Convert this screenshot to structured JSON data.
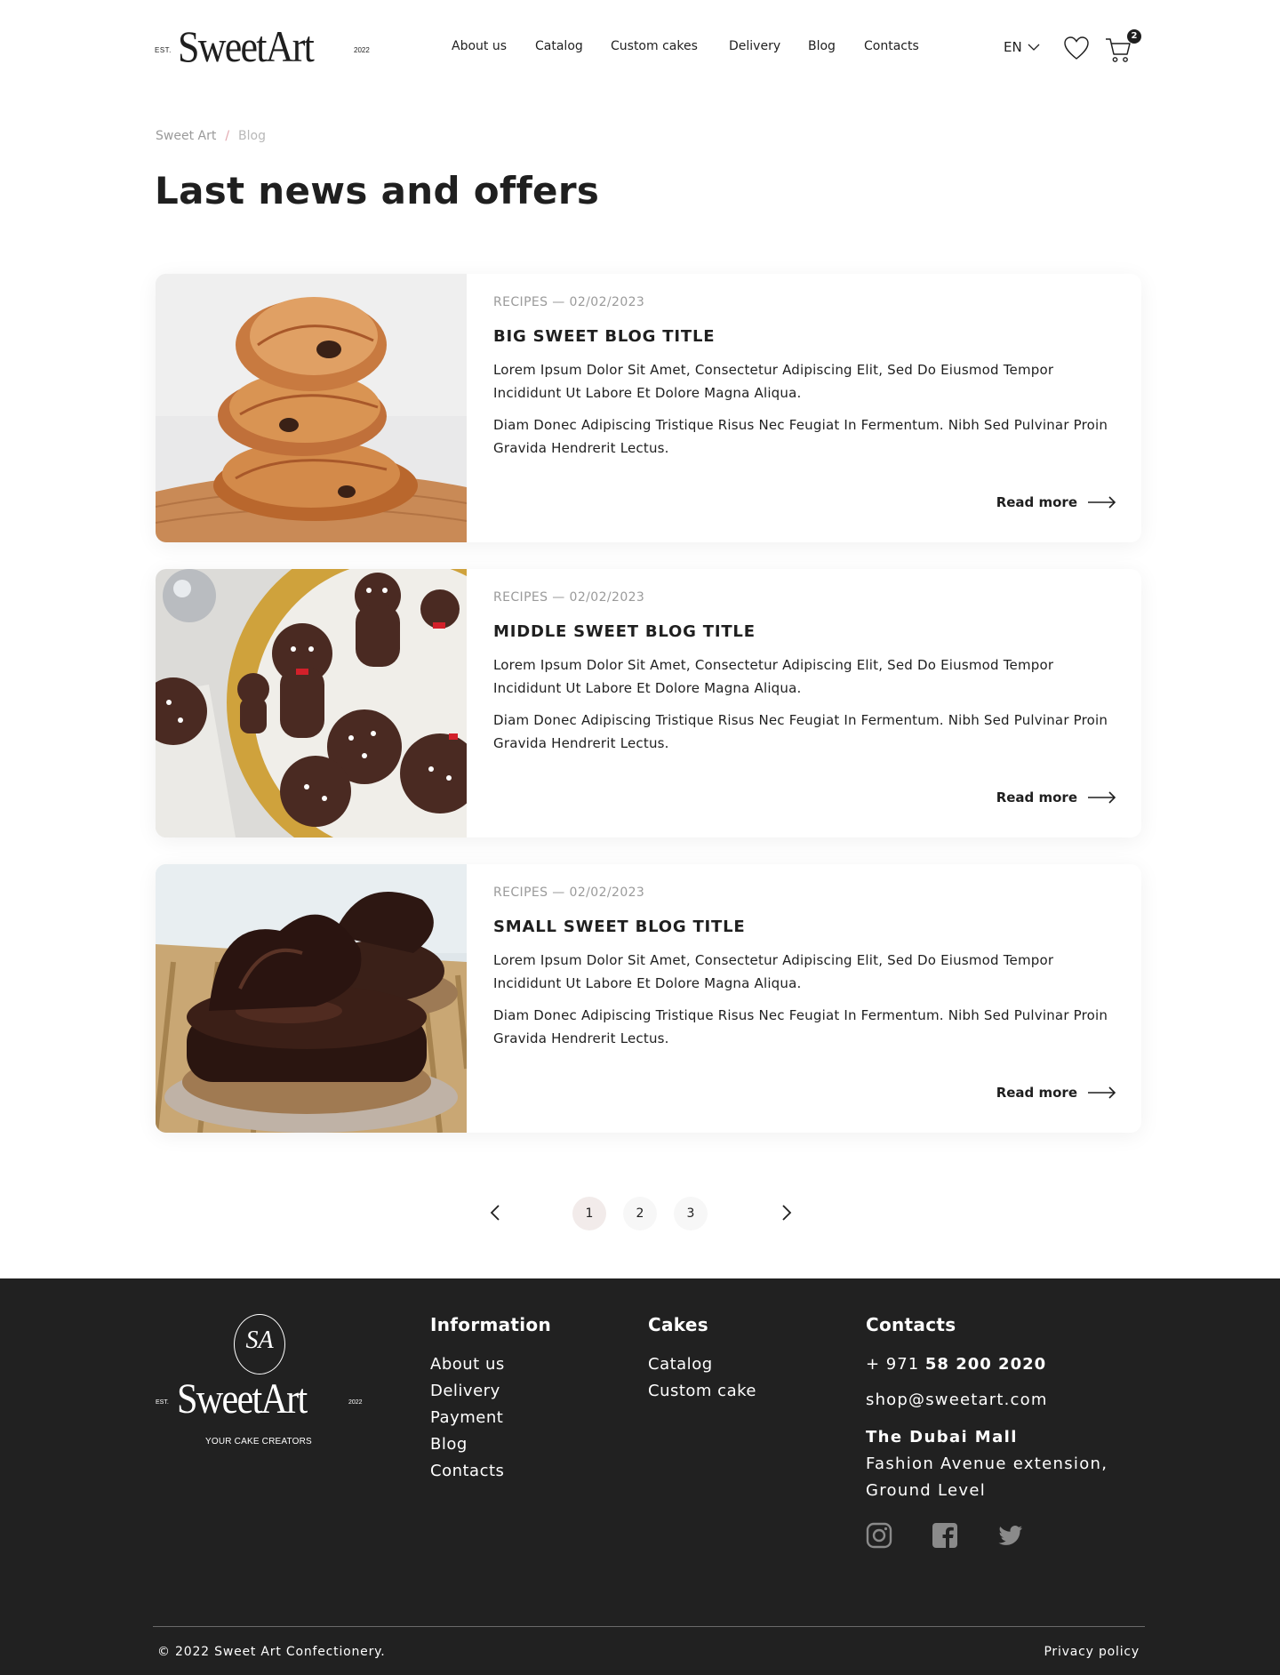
{
  "header": {
    "logo": {
      "est": "EST.",
      "brand": "SweetArt",
      "year": "2022"
    },
    "nav": [
      "About us",
      "Catalog",
      "Custom cakes",
      "Delivery",
      "Blog",
      "Contacts"
    ],
    "language": "EN",
    "cart_count": "2"
  },
  "breadcrumb": {
    "home": "Sweet Art",
    "separator": "/",
    "current": "Blog"
  },
  "page_title": "Last news and offers",
  "posts": [
    {
      "meta": "RECIPES — 02/02/2023",
      "title": "BIG SWEET BLOG TITLE",
      "p1": "Lorem Ipsum Dolor Sit Amet, Consectetur Adipiscing Elit, Sed Do Eiusmod Tempor Incididunt Ut Labore Et Dolore Magna Aliqua.",
      "p2": "Diam Donec Adipiscing Tristique Risus Nec Feugiat In Fermentum. Nibh Sed Pulvinar Proin Gravida Hendrerit Lectus.",
      "read_more": "Read more",
      "image": "croissant-stack"
    },
    {
      "meta": "RECIPES — 02/02/2023",
      "title": "MIDDLE SWEET BLOG TITLE",
      "p1": "Lorem Ipsum Dolor Sit Amet, Consectetur Adipiscing Elit, Sed Do Eiusmod Tempor Incididunt Ut Labore Et Dolore Magna Aliqua.",
      "p2": "Diam Donec Adipiscing Tristique Risus Nec Feugiat In Fermentum. Nibh Sed Pulvinar Proin Gravida Hendrerit Lectus.",
      "read_more": "Read more",
      "image": "gingerbread-cookies"
    },
    {
      "meta": "RECIPES — 02/02/2023",
      "title": "SMALL SWEET BLOG TITLE",
      "p1": "Lorem Ipsum Dolor Sit Amet, Consectetur Adipiscing Elit, Sed Do Eiusmod Tempor Incididunt Ut Labore Et Dolore Magna Aliqua.",
      "p2": "Diam Donec Adipiscing Tristique Risus Nec Feugiat In Fermentum. Nibh Sed Pulvinar Proin Gravida Hendrerit Lectus.",
      "read_more": "Read more",
      "image": "chocolate-tarts"
    }
  ],
  "pagination": {
    "pages": [
      "1",
      "2",
      "3"
    ],
    "active": "1"
  },
  "footer": {
    "logo": {
      "monogram": "SA",
      "est": "EST.",
      "brand": "SweetArt",
      "year": "2022",
      "tagline": "YOUR CAKE CREATORS"
    },
    "information": {
      "heading": "Information",
      "links": [
        "About us",
        "Delivery",
        "Payment",
        "Blog",
        "Contacts"
      ]
    },
    "cakes": {
      "heading": "Cakes",
      "links": [
        "Catalog",
        "Custom cake"
      ]
    },
    "contacts": {
      "heading": "Contacts",
      "phone_prefix": "+ 971",
      "phone_number": "58 200 2020",
      "email": "shop@sweetart.com",
      "mall": "The Dubai Mall",
      "address_line1": "Fashion Avenue extension,",
      "address_line2": "Ground Level"
    },
    "socials": [
      "instagram-icon",
      "facebook-icon",
      "twitter-icon"
    ],
    "copyright": "© 2022 Sweet Art Confectionery.",
    "privacy": "Privacy policy"
  },
  "colors": {
    "dark": "#212121",
    "accent_pink": "#e2a6ad",
    "muted": "#9a9a9a"
  }
}
